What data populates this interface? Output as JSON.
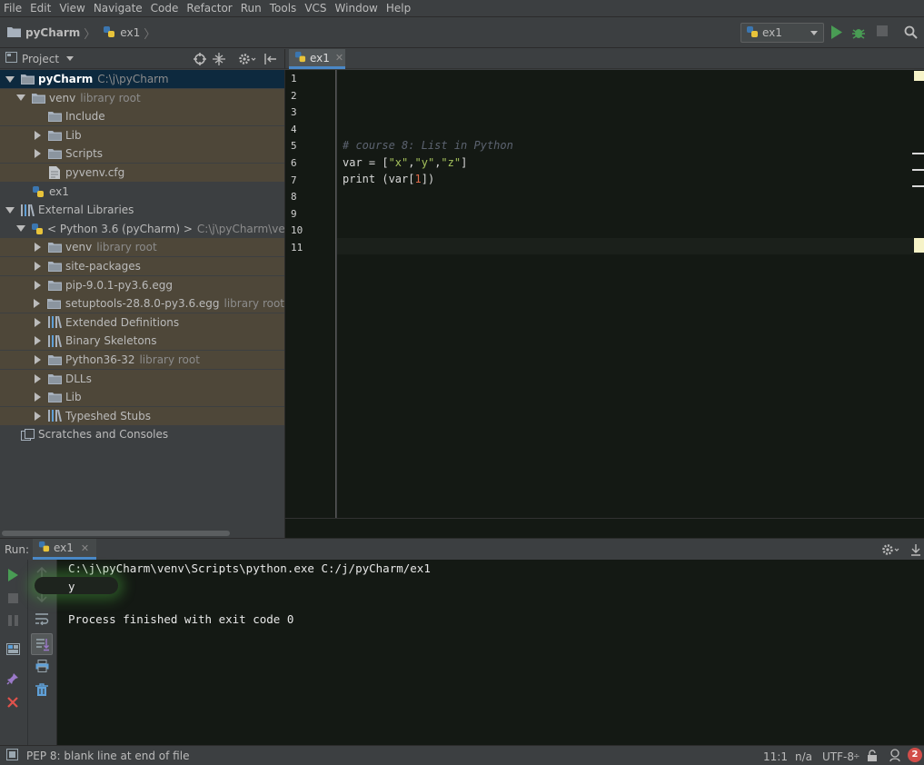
{
  "menu": [
    "File",
    "Edit",
    "View",
    "Navigate",
    "Code",
    "Refactor",
    "Run",
    "Tools",
    "VCS",
    "Window",
    "Help"
  ],
  "navbar": {
    "project": "pyCharm",
    "file": "ex1",
    "run_config": "ex1"
  },
  "project_panel": {
    "title": "Project",
    "tree": [
      {
        "name": "pyCharm",
        "hint": "C:\\j\\pyCharm",
        "icon": "folder-icon",
        "expanded": true
      },
      {
        "name": "venv",
        "hint": "library root",
        "icon": "folder-icon",
        "expanded": true
      },
      {
        "name": "Include",
        "hint": "",
        "icon": "folder-icon"
      },
      {
        "name": "Lib",
        "hint": "",
        "icon": "folder-icon"
      },
      {
        "name": "Scripts",
        "hint": "",
        "icon": "folder-icon"
      },
      {
        "name": "pyvenv.cfg",
        "hint": "",
        "icon": "file-icon"
      },
      {
        "name": "ex1",
        "hint": "",
        "icon": "python-file-icon"
      },
      {
        "name": "External Libraries",
        "hint": "",
        "icon": "library-icon",
        "expanded": true
      },
      {
        "name": "< Python 3.6 (pyCharm) >",
        "hint": "C:\\j\\pyCharm\\venv\\Scrip",
        "icon": "python-icon",
        "expanded": true
      },
      {
        "name": "venv",
        "hint": "library root",
        "icon": "folder-icon"
      },
      {
        "name": "site-packages",
        "hint": "",
        "icon": "folder-icon"
      },
      {
        "name": "pip-9.0.1-py3.6.egg",
        "hint": "",
        "icon": "folder-icon"
      },
      {
        "name": "setuptools-28.8.0-py3.6.egg",
        "hint": "library root",
        "icon": "folder-icon"
      },
      {
        "name": "Extended Definitions",
        "hint": "",
        "icon": "library-icon"
      },
      {
        "name": "Binary Skeletons",
        "hint": "",
        "icon": "library-icon"
      },
      {
        "name": "Python36-32",
        "hint": "library root",
        "icon": "folder-icon"
      },
      {
        "name": "DLLs",
        "hint": "",
        "icon": "folder-icon"
      },
      {
        "name": "Lib",
        "hint": "",
        "icon": "folder-icon"
      },
      {
        "name": "Typeshed Stubs",
        "hint": "",
        "icon": "library-icon"
      },
      {
        "name": "Scratches and Consoles",
        "hint": "",
        "icon": "scratches-icon"
      }
    ]
  },
  "editor": {
    "tab": "ex1",
    "line_numbers": [
      "1",
      "2",
      "3",
      "4",
      "5",
      "6",
      "7",
      "8",
      "9",
      "10",
      "11"
    ],
    "code": {
      "comment": "# course 8: List in Python",
      "l6_var": "var = [",
      "l6_s1": "\"x\"",
      "l6_c1": ",",
      "l6_s2": "\"y\"",
      "l6_c2": ",",
      "l6_s3": "\"z\"",
      "l6_end": "]",
      "l7_a": "print (var[",
      "l7_num": "1",
      "l7_b": "])"
    }
  },
  "run_panel": {
    "title": "Run:",
    "tab": "ex1",
    "output": [
      "C:\\j\\pyCharm\\venv\\Scripts\\python.exe C:/j/pyCharm/ex1",
      "y",
      "",
      "Process finished with exit code 0"
    ]
  },
  "status_bar": {
    "message": "PEP 8: blank line at end of file",
    "position": "11:1",
    "na": "n/a",
    "encoding": "UTF-8",
    "notifications": "2"
  },
  "colors": {
    "accent": "#4a88c7",
    "run_green": "#499c54",
    "stop_red": "#c75450",
    "library_bg": "#4e4739"
  }
}
